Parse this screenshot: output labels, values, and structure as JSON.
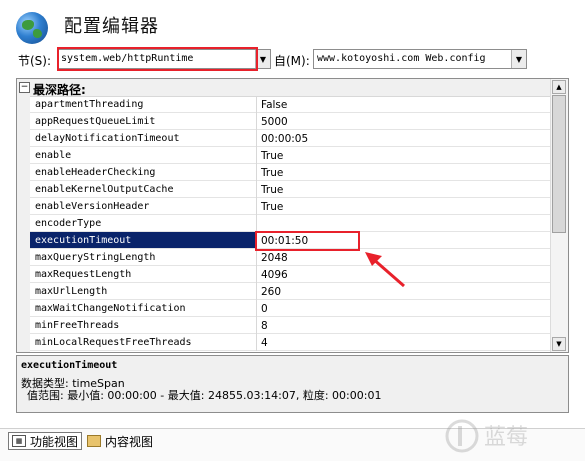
{
  "header": {
    "title": "配置编辑器"
  },
  "section": {
    "label": "节(S):",
    "value": "system.web/httpRuntime",
    "from_label": "自(M):",
    "from_value": "www.kotoyoshi.com Web.config"
  },
  "grid": {
    "category": "最深路径:",
    "rows": [
      {
        "name": "apartmentThreading",
        "value": "False"
      },
      {
        "name": "appRequestQueueLimit",
        "value": "5000"
      },
      {
        "name": "delayNotificationTimeout",
        "value": "00:00:05"
      },
      {
        "name": "enable",
        "value": "True"
      },
      {
        "name": "enableHeaderChecking",
        "value": "True"
      },
      {
        "name": "enableKernelOutputCache",
        "value": "True"
      },
      {
        "name": "enableVersionHeader",
        "value": "True"
      },
      {
        "name": "encoderType",
        "value": ""
      },
      {
        "name": "executionTimeout",
        "value": "00:01:50"
      },
      {
        "name": "maxQueryStringLength",
        "value": "2048"
      },
      {
        "name": "maxRequestLength",
        "value": "4096"
      },
      {
        "name": "maxUrlLength",
        "value": "260"
      },
      {
        "name": "maxWaitChangeNotification",
        "value": "0"
      },
      {
        "name": "minFreeThreads",
        "value": "8"
      },
      {
        "name": "minLocalRequestFreeThreads",
        "value": "4"
      }
    ],
    "selected_index": 8
  },
  "description": {
    "name": "executionTimeout",
    "type_line": "数据类型: timeSpan",
    "range_line": "值范围: 最小值: 00:00:00 - 最大值: 24855.03:14:07, 粒度: 00:00:01"
  },
  "bottom": {
    "tab_features": "功能视图",
    "tab_content": "内容视图"
  },
  "watermark": {
    "text": "蓝莓"
  },
  "colors": {
    "highlight": "#e8212b",
    "selection": "#0a246a"
  }
}
